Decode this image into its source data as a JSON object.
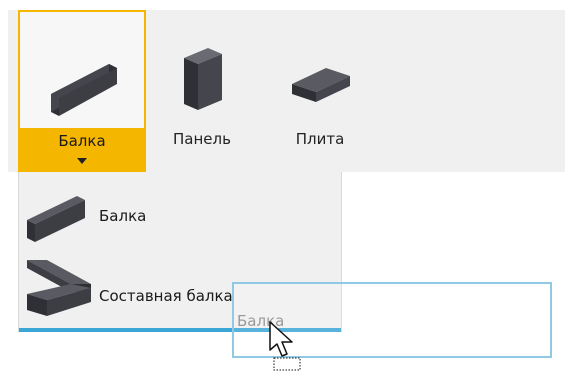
{
  "ribbon": {
    "buttons": [
      {
        "label": "Балка",
        "icon": "beam-icon",
        "selected": true
      },
      {
        "label": "Панель",
        "icon": "panel-icon"
      },
      {
        "label": "Плита",
        "icon": "slab-icon"
      }
    ]
  },
  "dropdown": {
    "items": [
      {
        "label": "Балка",
        "icon": "beam-icon"
      },
      {
        "label": "Составная балка",
        "icon": "composite-beam-icon"
      }
    ]
  },
  "drag": {
    "label": "Балка",
    "cursor": "move-cursor-icon"
  },
  "colors": {
    "selected_highlight": "#f5b600",
    "accent_blue": "#3aa6d6",
    "icon_dark": "#3d3d44"
  }
}
